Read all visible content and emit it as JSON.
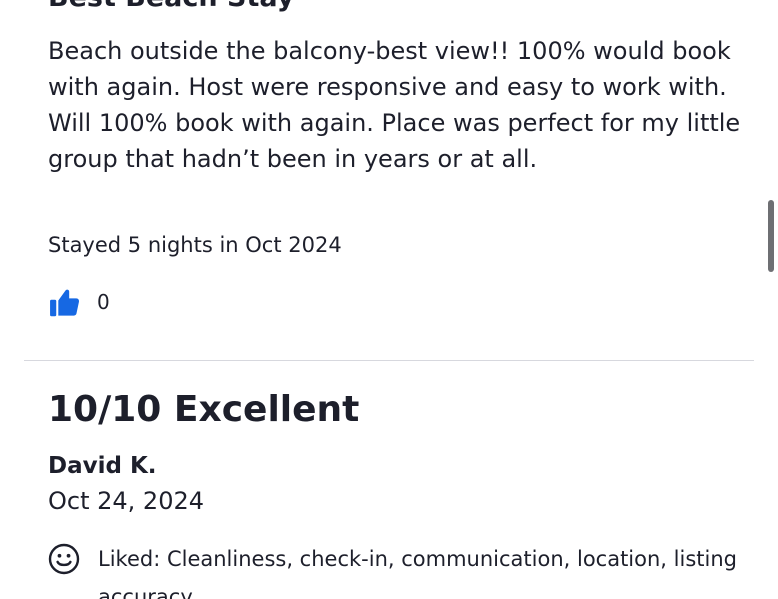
{
  "review_prev": {
    "title": "Best Beach Stay",
    "body": "Beach outside the balcony-best view!! 100% would book with again. Host were responsive and easy to work with. Will 100% book with again. Place was perfect for my little group that hadn’t been in years or at all.",
    "stay_info": "Stayed 5 nights in Oct 2024",
    "helpful_icon": "thumbs-up-icon",
    "helpful_count": "0"
  },
  "review_next": {
    "rating_headline": "10/10 Excellent",
    "reviewer_name": "David K.",
    "date": "Oct 24, 2024",
    "liked_icon": "smiley-icon",
    "liked_text": "Liked: Cleanliness, check-in, communication, location, listing accuracy"
  },
  "colors": {
    "text": "#1d1f2b",
    "accent_blue": "#1668e3",
    "divider": "#d7d8de",
    "scrollbar": "#6e6f73"
  }
}
